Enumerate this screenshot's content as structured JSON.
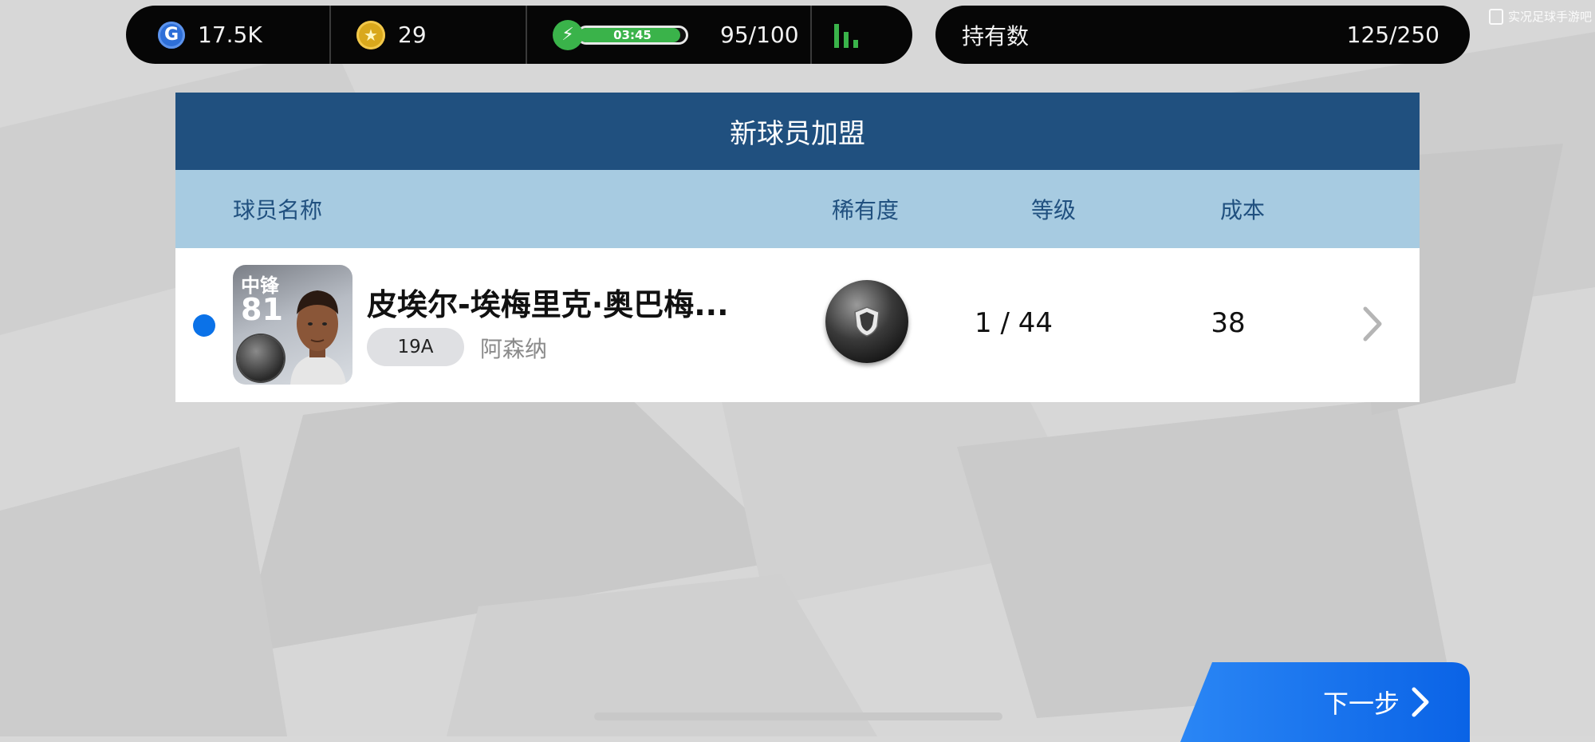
{
  "status_bar": {
    "gp": "17.5K",
    "coins": "29",
    "stamina_timer": "03:45",
    "stamina_fill_fraction": 0.95,
    "stamina": "95/100"
  },
  "holdings": {
    "label": "持有数",
    "value": "125/250"
  },
  "watermark": "实况足球手游吧",
  "panel": {
    "title": "新球员加盟",
    "headers": {
      "name": "球员名称",
      "rarity": "稀有度",
      "level": "等级",
      "cost": "成本"
    }
  },
  "player": {
    "position": "中锋",
    "rating": "81",
    "name": "皮埃尔-埃梅里克·奥巴梅...",
    "season": "19A",
    "club": "阿森纳",
    "level": "1 / 44",
    "cost": "38"
  },
  "next_button": {
    "label": "下一步"
  },
  "colors": {
    "panel_title_bg": "#20507f",
    "header_bg": "#a7cbe1",
    "accent_blue": "#0b72e8",
    "stamina_green": "#3ab34a"
  },
  "icons": [
    "gp-icon",
    "coin-icon",
    "stamina-bolt-icon",
    "signal-icon",
    "chevron-right-icon",
    "black-ball-rarity-icon"
  ]
}
